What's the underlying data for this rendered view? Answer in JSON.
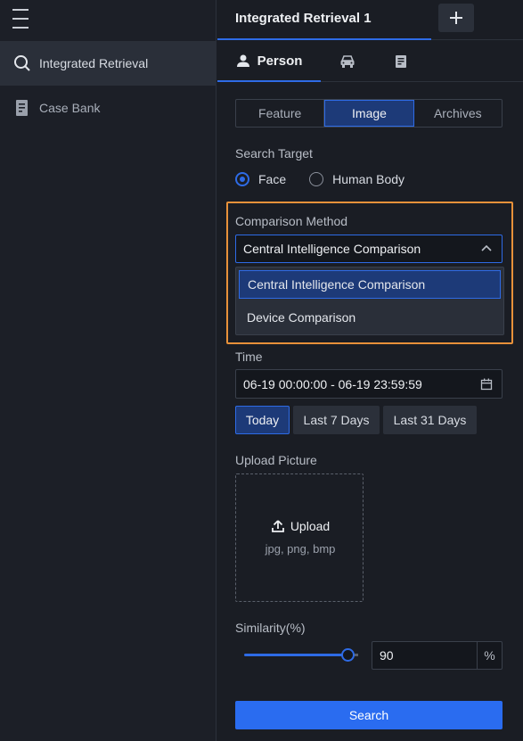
{
  "sidebar": {
    "items": [
      {
        "label": "Integrated Retrieval",
        "icon": "search-icon"
      },
      {
        "label": "Case Bank",
        "icon": "document-icon"
      }
    ]
  },
  "header": {
    "tab_title": "Integrated Retrieval 1",
    "add_tab_icon": "plus-icon"
  },
  "category_tabs": {
    "person_label": "Person",
    "vehicle_icon": "car-icon",
    "file_icon": "file-icon"
  },
  "mode_tabs": [
    "Feature",
    "Image",
    "Archives"
  ],
  "search_target": {
    "label": "Search Target",
    "options": [
      "Face",
      "Human Body"
    ],
    "selected": "Face"
  },
  "comparison": {
    "label": "Comparison Method",
    "value": "Central Intelligence Comparison",
    "options": [
      "Central Intelligence Comparison",
      "Device Comparison"
    ]
  },
  "time": {
    "label": "Time",
    "value": "06-19 00:00:00 - 06-19 23:59:59",
    "quick": [
      "Today",
      "Last 7 Days",
      "Last 31 Days"
    ]
  },
  "upload": {
    "label": "Upload Picture",
    "button": "Upload",
    "hint": "jpg, png, bmp"
  },
  "similarity": {
    "label": "Similarity(%)",
    "value": "90",
    "unit": "%"
  },
  "search_button": "Search",
  "colors": {
    "accent": "#2e6be6",
    "highlight": "#e8913a"
  }
}
